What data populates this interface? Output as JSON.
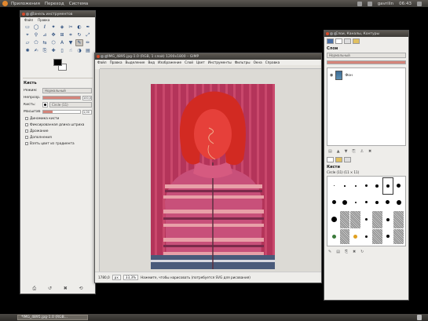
{
  "top_panel": {
    "menus": [
      "Приложения",
      "Переход",
      "Система"
    ],
    "clock": "06:43",
    "user": "gavrilin"
  },
  "toolbox": {
    "title": "Панель инструментов",
    "menus": [
      "Файл",
      "Правка"
    ],
    "options_title": "Кисть",
    "mode_label": "Режим:",
    "mode_value": "Нормальный",
    "opacity_label": "Непрозр.:",
    "opacity_value": "100,0",
    "brush_label": "Кисть:",
    "brush_value": "Circle (11)",
    "scale_label": "Масштаб:",
    "scale_value": "1,00",
    "checks": [
      "Динамика кисти",
      "Фиксированная длина штриха",
      "Дрожание",
      "Дополнения",
      "Взять цвет из градиента"
    ]
  },
  "main_window": {
    "title": "*IMG_4895.jpg-1.0 (RGB, 1 слой) 1200x1800 – GIMP",
    "menus": [
      "Файл",
      "Правка",
      "Выделение",
      "Вид",
      "Изображение",
      "Слой",
      "Цвет",
      "Инструменты",
      "Фильтры",
      "Окна",
      "Справка"
    ],
    "status_coords": "1780,0",
    "status_unit": "px",
    "status_zoom": "33,3%",
    "status_msg": "Нажмите, чтобы нарисовать (потребуется SVG для рисования)"
  },
  "dock": {
    "title": "Слои, Каналы, Контуры",
    "layers_title": "Слои",
    "mode_value": "Нормальный",
    "layer_name": "Фон",
    "brushes_title": "Кисти",
    "brush_info": "Circle (11) (11 × 11)"
  },
  "taskbar": {
    "item": "*IMG_4895.jpg-1.0 (RGB..."
  },
  "colors": {
    "red_overlay": "#e0342a",
    "sweater": "#c2456a"
  }
}
